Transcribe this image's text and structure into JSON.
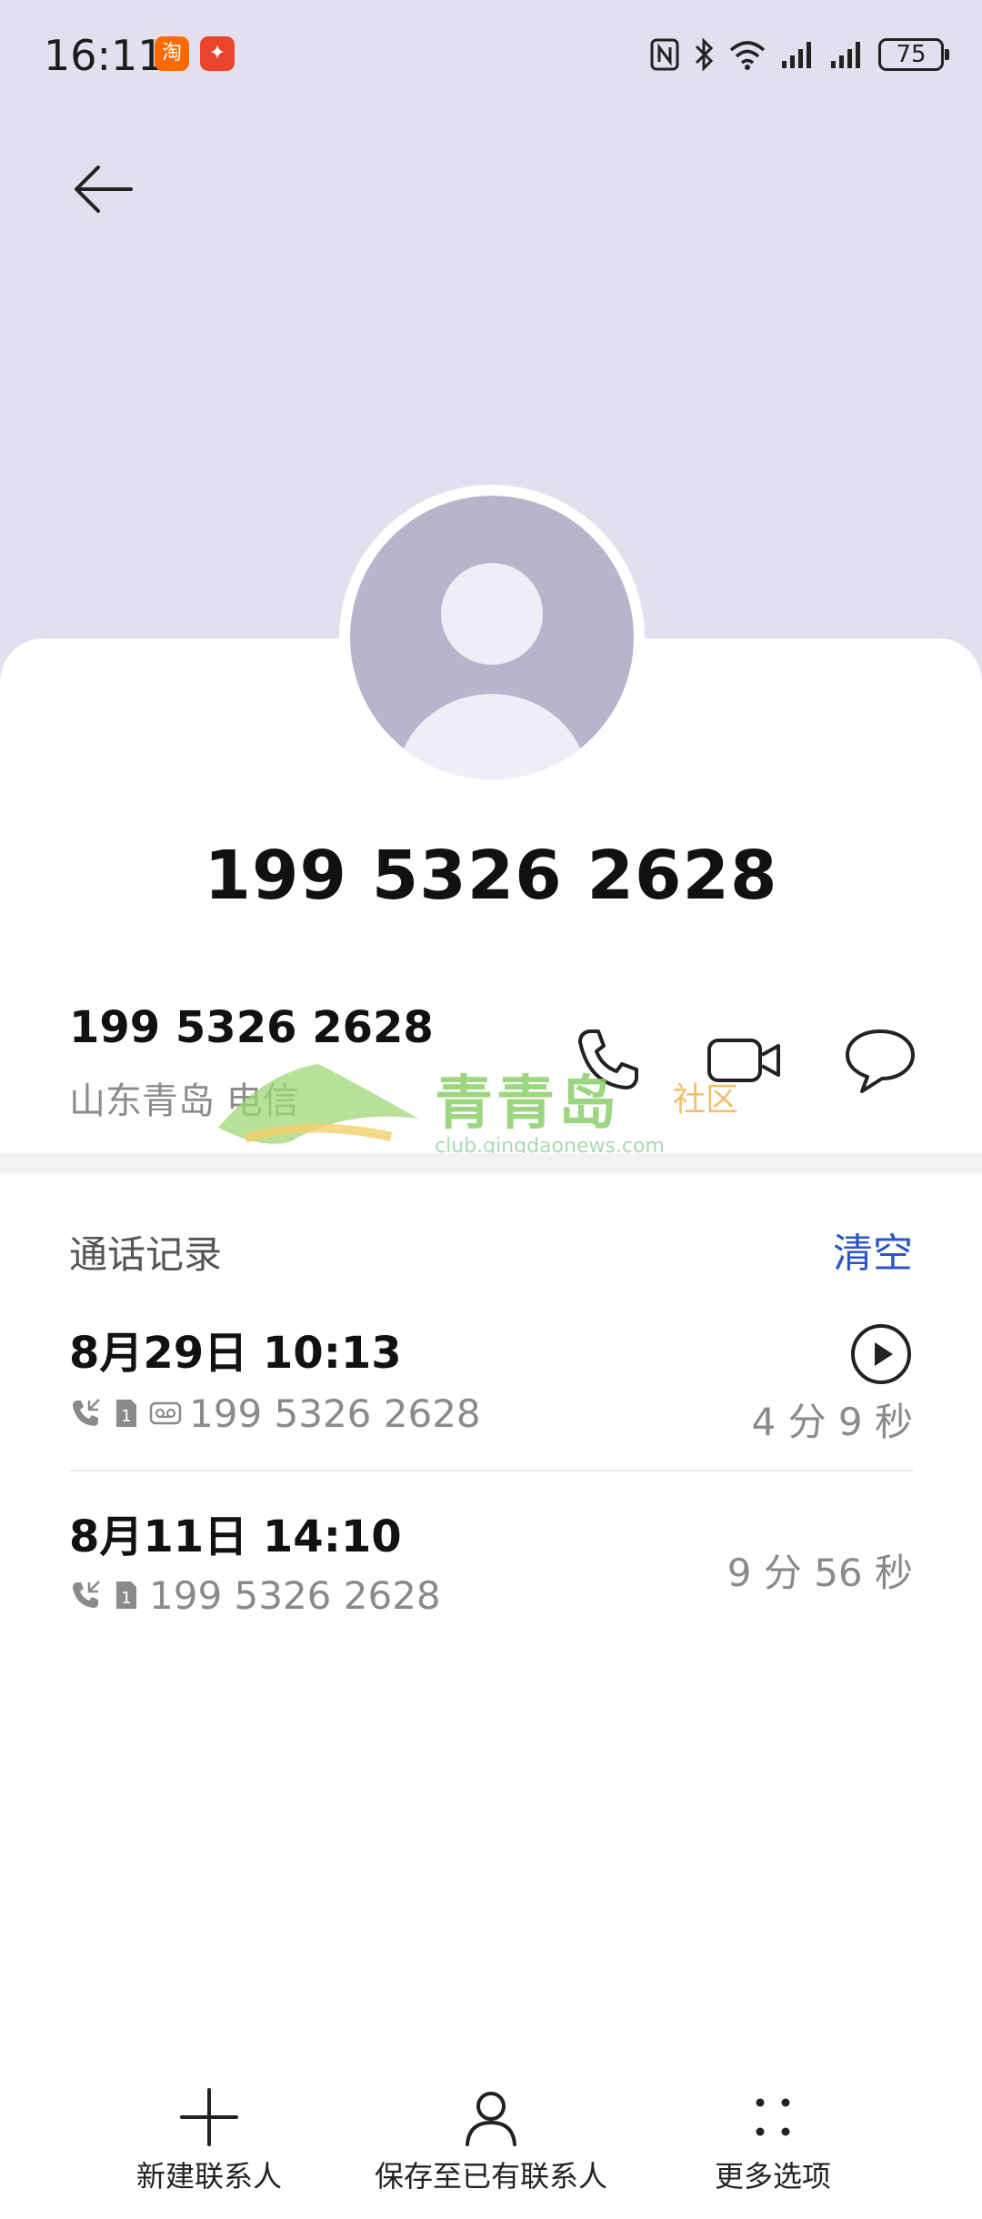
{
  "status_bar": {
    "time": "16:11",
    "apps": [
      {
        "name": "taobao-app-icon",
        "glyph": "淘",
        "color": "#ff6a00"
      },
      {
        "name": "red-app-icon",
        "glyph": "✦",
        "color": "#e8452c"
      }
    ],
    "battery": "75"
  },
  "header": {
    "back_icon": "arrow-left-icon"
  },
  "contact": {
    "title": "199 5326 2628",
    "number": "199 5326 2628",
    "location": "山东青岛 电信"
  },
  "watermark": {
    "text": "青青岛",
    "tag": "社区",
    "url": "club.qingdaonews.com"
  },
  "call_log": {
    "title": "通话记录",
    "clear_label": "清空",
    "entries": [
      {
        "date": "8月29日 10:13",
        "number": "199 5326 2628",
        "duration": "4 分 9 秒",
        "has_recording": true
      },
      {
        "date": "8月11日 14:10",
        "number": "199 5326 2628",
        "duration": "9 分 56 秒",
        "has_recording": false
      }
    ]
  },
  "bottom_bar": {
    "new_contact": "新建联系人",
    "save_existing": "保存至已有联系人",
    "more": "更多选项"
  },
  "colors": {
    "header_bg": "#e3dfef",
    "accent": "#2a56c6",
    "avatar": "#b9b4cb"
  }
}
